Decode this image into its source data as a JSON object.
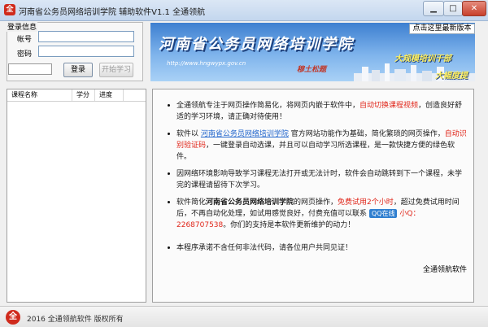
{
  "window": {
    "title": "河南省公务员网络培训学院 辅助软件V1.1 全通领航",
    "app_icon_glyph": "全",
    "minimize_glyph": "▁",
    "maximize_glyph": "□",
    "close_glyph": "✕"
  },
  "login": {
    "group_title": "登录信息",
    "account_label": "帐号",
    "password_label": "密码",
    "account_value": "",
    "password_value": "",
    "captcha_value": "",
    "login_button": "登录",
    "start_button": "开始学习"
  },
  "banner": {
    "title": "河南省公务员网络培训学院",
    "url": "http://www.hngwypx.gov.cn",
    "slogan": "穆土松题",
    "ad_line1": "大规模培训干部",
    "ad_line2": "大幅度提",
    "update_link": "点击这里最新版本"
  },
  "course_table": {
    "columns": [
      "课程名称",
      "学分",
      "进度"
    ]
  },
  "notice": {
    "p1_a": "全通领航专注于网页操作简易化，将网页内嵌于软件中，",
    "p1_b": "自动切换课程视频",
    "p1_c": "，创造良好舒适的学习环境，请正确对待使用！",
    "p2_a": "软件以 ",
    "p2_link": "河南省公务员网络培训学院",
    "p2_b": " 官方网站功能作为基础，简化繁琐的网页操作，",
    "p2_red": "自动识别验证码",
    "p2_c": "，一键登录自动选课，并且可以自动学习所选课程，是一款快捷方便的绿色软件。",
    "p3": "因网络环境影响导致学习课程无法打开或无法计时，软件会自动跳转到下一个课程，未学完的课程请留待下次学习。",
    "p4_a": "软件简化",
    "p4_bold": "河南省公务员网络培训学院",
    "p4_b": "的网页操作，",
    "p4_red1": "免费试用2个小时",
    "p4_c": "，超过免费试用时间后，不再自动化处理，如试用感觉良好，付费充值可以联系",
    "qq_badge": "QQ在线",
    "p4_contact": "小Q：2268707538",
    "p4_d": "。你们的支持是本软件更新维护的动力！",
    "p5": "本程序承诺不含任何非法代码，请各位用户共同见证！",
    "signature": "全通领航软件"
  },
  "statusbar": {
    "icon_glyph": "全",
    "text": "2016 全通领航软件 版权所有"
  }
}
